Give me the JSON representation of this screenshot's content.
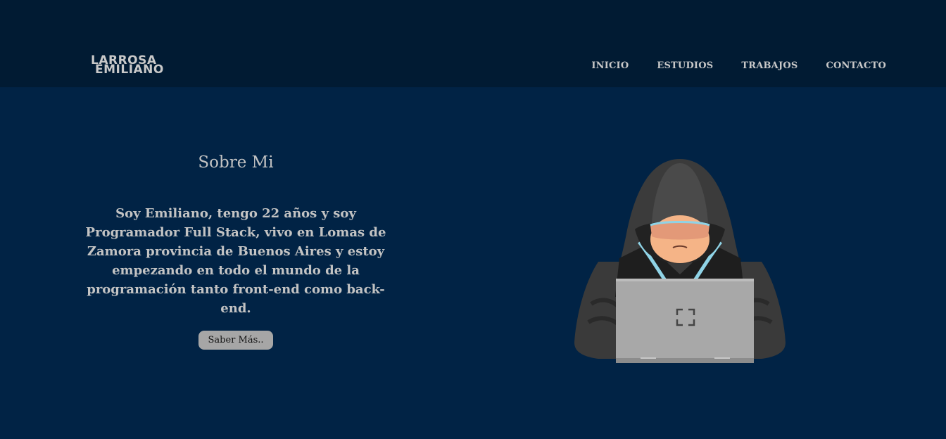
{
  "header": {
    "logo_line1": "LARROSA",
    "logo_line2": "EMILIANO",
    "nav": [
      "INICIO",
      "ESTUDIOS",
      "TRABAJOS",
      "CONTACTO"
    ]
  },
  "about": {
    "title": "Sobre Mi",
    "text": "Soy Emiliano, tengo 22 años y soy Programador Full Stack, vivo en Lomas de Zamora provincia de Buenos Aires y estoy empezando en todo el mundo de la programación tanto front-end como back-end.",
    "button": "Saber Más.."
  },
  "colors": {
    "background": "#012345",
    "header": "#011b33",
    "text": "#c3c3c3",
    "button": "#a6a6a6"
  },
  "illustration": {
    "icon": "hooded-hacker-laptop-illustration"
  }
}
